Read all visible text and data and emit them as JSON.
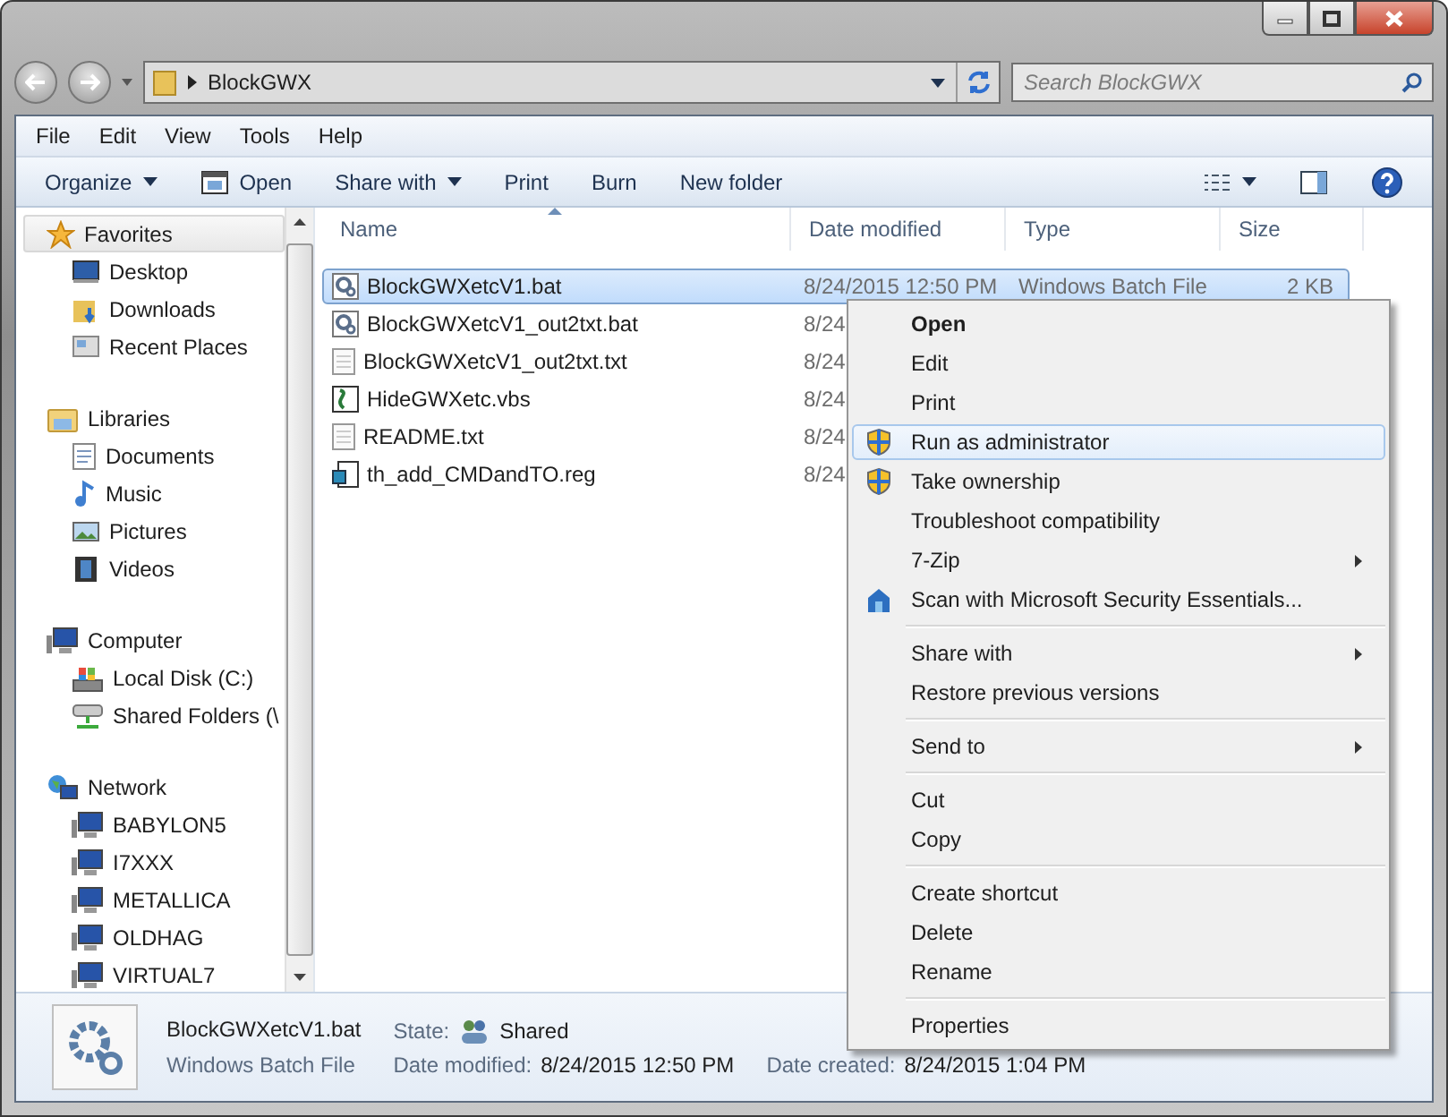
{
  "address_bar": {
    "path": "BlockGWX"
  },
  "search": {
    "placeholder": "Search BlockGWX"
  },
  "menu_bar": [
    "File",
    "Edit",
    "View",
    "Tools",
    "Help"
  ],
  "toolbar": [
    {
      "label": "Organize",
      "dropdown": true
    },
    {
      "label": "Open",
      "dropdown": false
    },
    {
      "label": "Share with",
      "dropdown": true
    },
    {
      "label": "Print",
      "dropdown": false
    },
    {
      "label": "Burn",
      "dropdown": false
    },
    {
      "label": "New folder",
      "dropdown": false
    }
  ],
  "sidebar": [
    {
      "label": "Favorites",
      "kind": "star",
      "highlighted": true,
      "children": [
        {
          "label": "Desktop",
          "kind": "desktop"
        },
        {
          "label": "Downloads",
          "kind": "downloads"
        },
        {
          "label": "Recent Places",
          "kind": "recent"
        }
      ]
    },
    {
      "label": "Libraries",
      "kind": "libraries",
      "highlighted": false,
      "children": [
        {
          "label": "Documents",
          "kind": "document"
        },
        {
          "label": "Music",
          "kind": "music"
        },
        {
          "label": "Pictures",
          "kind": "pictures"
        },
        {
          "label": "Videos",
          "kind": "videos"
        }
      ]
    },
    {
      "label": "Computer",
      "kind": "computer",
      "highlighted": false,
      "children": [
        {
          "label": "Local Disk (C:)",
          "kind": "disk"
        },
        {
          "label": "Shared Folders (\\",
          "kind": "shared"
        }
      ]
    },
    {
      "label": "Network",
      "kind": "network",
      "highlighted": false,
      "children": [
        {
          "label": "BABYLON5",
          "kind": "computer"
        },
        {
          "label": "I7XXX",
          "kind": "computer"
        },
        {
          "label": "METALLICA",
          "kind": "computer"
        },
        {
          "label": "OLDHAG",
          "kind": "computer"
        },
        {
          "label": "VIRTUAL7",
          "kind": "computer"
        }
      ]
    }
  ],
  "table": {
    "columns": [
      "Name",
      "Date modified",
      "Type",
      "Size"
    ],
    "rows": [
      {
        "name": "BlockGWXetcV1.bat",
        "date": "8/24/2015 12:50 PM",
        "type": "Windows Batch File",
        "size": "2 KB",
        "kind": "batch",
        "selected": true
      },
      {
        "name": "BlockGWXetcV1_out2txt.bat",
        "date": "8/24",
        "kind": "batch",
        "selected": false
      },
      {
        "name": "BlockGWXetcV1_out2txt.txt",
        "date": "8/24",
        "kind": "text",
        "selected": false
      },
      {
        "name": "HideGWXetc.vbs",
        "date": "8/24",
        "kind": "script",
        "selected": false
      },
      {
        "name": "README.txt",
        "date": "8/24",
        "kind": "text",
        "selected": false
      },
      {
        "name": "th_add_CMDandTO.reg",
        "date": "8/24",
        "kind": "registry",
        "selected": false
      }
    ]
  },
  "context_menu": [
    {
      "kind": "item",
      "label": "Open",
      "bold": true,
      "submenu": false,
      "selected": false
    },
    {
      "kind": "item",
      "label": "Edit",
      "bold": false,
      "submenu": false,
      "selected": false
    },
    {
      "kind": "item",
      "label": "Print",
      "bold": false,
      "submenu": false,
      "selected": false
    },
    {
      "kind": "shield",
      "label": "Run as administrator",
      "bold": false,
      "submenu": false,
      "selected": true
    },
    {
      "kind": "shield",
      "label": "Take ownership",
      "bold": false,
      "submenu": false,
      "selected": false
    },
    {
      "kind": "item",
      "label": "Troubleshoot compatibility",
      "bold": false,
      "submenu": false,
      "selected": false
    },
    {
      "kind": "item",
      "label": "7-Zip",
      "bold": false,
      "submenu": true,
      "selected": false
    },
    {
      "kind": "scan",
      "label": "Scan with Microsoft Security Essentials...",
      "bold": false,
      "submenu": false,
      "selected": false
    },
    {
      "kind": "separator"
    },
    {
      "kind": "item",
      "label": "Share with",
      "bold": false,
      "submenu": true,
      "selected": false
    },
    {
      "kind": "item",
      "label": "Restore previous versions",
      "bold": false,
      "submenu": false,
      "selected": false
    },
    {
      "kind": "separator"
    },
    {
      "kind": "item",
      "label": "Send to",
      "bold": false,
      "submenu": true,
      "selected": false
    },
    {
      "kind": "separator"
    },
    {
      "kind": "item",
      "label": "Cut",
      "bold": false,
      "submenu": false,
      "selected": false
    },
    {
      "kind": "item",
      "label": "Copy",
      "bold": false,
      "submenu": false,
      "selected": false
    },
    {
      "kind": "separator"
    },
    {
      "kind": "item",
      "label": "Create shortcut",
      "bold": false,
      "submenu": false,
      "selected": false
    },
    {
      "kind": "item",
      "label": "Delete",
      "bold": false,
      "submenu": false,
      "selected": false
    },
    {
      "kind": "item",
      "label": "Rename",
      "bold": false,
      "submenu": false,
      "selected": false
    },
    {
      "kind": "separator"
    },
    {
      "kind": "item",
      "label": "Properties",
      "bold": false,
      "submenu": false,
      "selected": false
    }
  ],
  "details_pane": {
    "name": "BlockGWXetcV1.bat",
    "type": "Windows Batch File",
    "fields": [
      {
        "label": "State:",
        "value": "Shared"
      },
      {
        "label": "Date modified:",
        "value": "8/24/2015 12:50 PM"
      },
      {
        "label": "Date created:",
        "value": "8/24/2015 1:04 PM"
      }
    ]
  }
}
